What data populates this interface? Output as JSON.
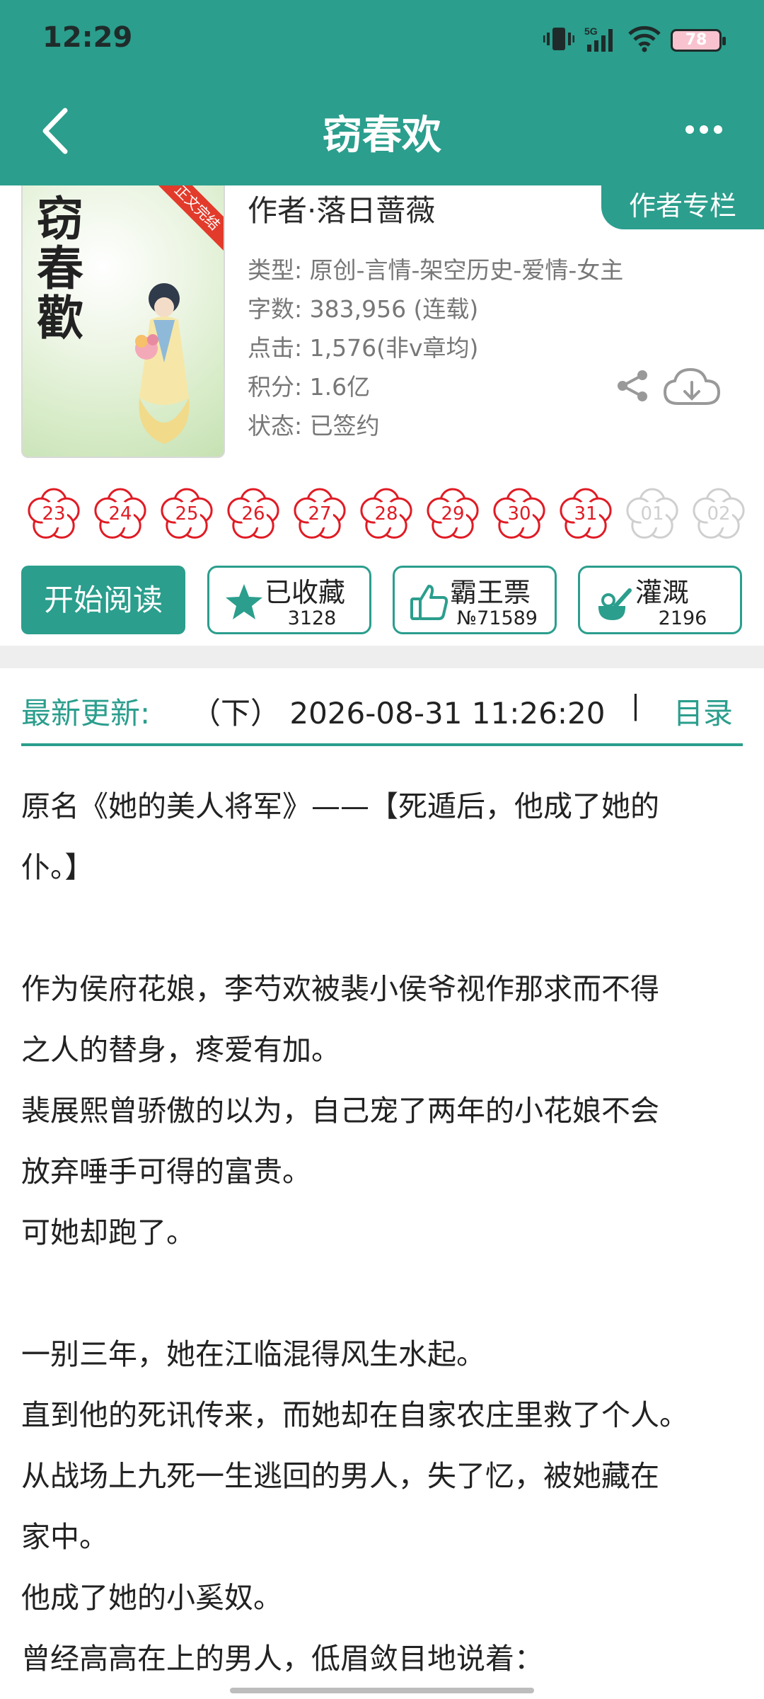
{
  "status_bar": {
    "time": "12:29",
    "battery": "78",
    "network": "5G"
  },
  "header": {
    "title": "窃春欢"
  },
  "book": {
    "cover_title": "窃春歡",
    "cover_badge": "正文完结",
    "author": "作者·落日蔷薇",
    "author_column_label": "作者专栏",
    "meta": [
      "类型: 原创-言情-架空历史-爱情-女主",
      "字数: 383,956 (连载)",
      "点击: 1,576(非v章均)",
      "积分: 1.6亿",
      "状态: 已签约"
    ]
  },
  "flowers": [
    {
      "num": "23",
      "active": true
    },
    {
      "num": "24",
      "active": true
    },
    {
      "num": "25",
      "active": true
    },
    {
      "num": "26",
      "active": true
    },
    {
      "num": "27",
      "active": true
    },
    {
      "num": "28",
      "active": true
    },
    {
      "num": "29",
      "active": true
    },
    {
      "num": "30",
      "active": true
    },
    {
      "num": "31",
      "active": true
    },
    {
      "num": "01",
      "active": false
    },
    {
      "num": "02",
      "active": false
    }
  ],
  "actions": {
    "read_label": "开始阅读",
    "collect": {
      "label": "已收藏",
      "count": "3128",
      "icon": "star-icon"
    },
    "ticket": {
      "label": "霸王票",
      "count": "№71589",
      "icon": "thumbs-up-icon"
    },
    "water": {
      "label": "灌溉",
      "count": "2196",
      "icon": "watering-icon"
    }
  },
  "update": {
    "label": "最新更新:",
    "value": "（下） 2026-08-31 11:26:20",
    "separator": "|",
    "toc_label": "目录"
  },
  "summary": [
    "原名《她的美人将军》——【死遁后，他成了她的",
    "仆。】",
    "",
    "作为侯府花娘，李芍欢被裴小侯爷视作那求而不得",
    "之人的替身，疼爱有加。",
    "裴展熙曾骄傲的以为，自己宠了两年的小花娘不会",
    "放弃唾手可得的富贵。",
    "可她却跑了。",
    "",
    "一别三年，她在江临混得风生水起。",
    "直到他的死讯传来，而她却在自家农庄里救了个人。",
    "从战场上九死一生逃回的男人，失了忆，被她藏在",
    "家中。",
    "他成了她的小奚奴。",
    "曾经高高在上的男人，低眉敛目地说着："
  ],
  "colors": {
    "primary": "#2b9e8d",
    "flower_red": "#e01b24",
    "flower_off": "#cfcfcf"
  }
}
